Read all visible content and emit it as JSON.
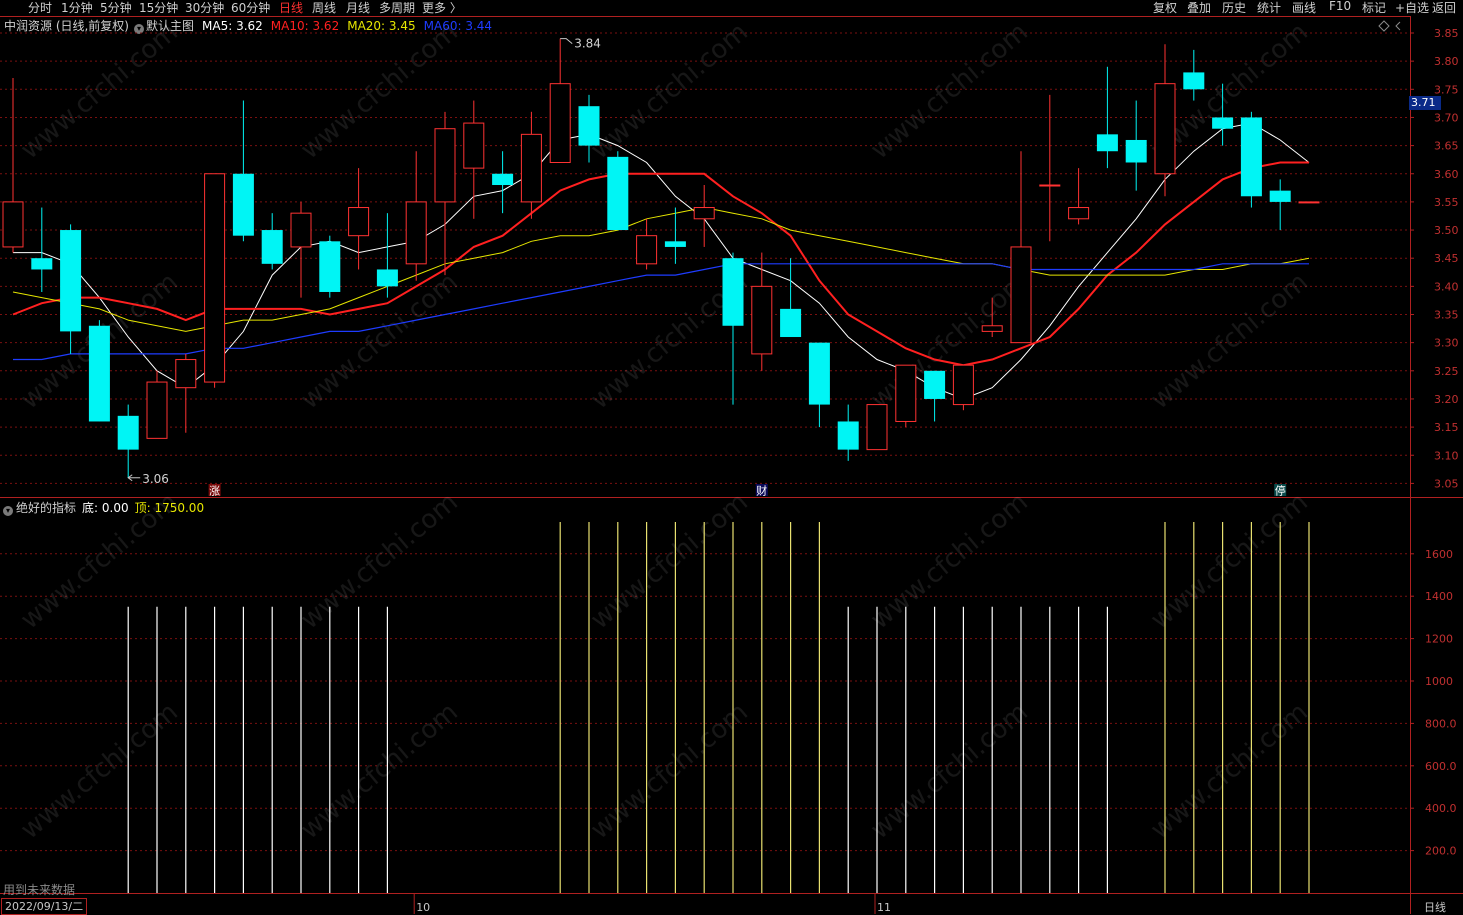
{
  "toolbar": {
    "left": [
      "分时",
      "1分钟",
      "5分钟",
      "15分钟",
      "30分钟",
      "60分钟",
      "日线",
      "周线",
      "月线",
      "多周期",
      "更多 〉"
    ],
    "active": "日线",
    "right": [
      "复权",
      "叠加",
      "历史",
      "统计",
      "画线",
      "F10",
      "标记",
      "+自选",
      "返回"
    ]
  },
  "legend": {
    "stock": "中润资源 (日线,前复权)",
    "template": "默认主图",
    "ma5": "MA5: 3.62",
    "ma10": "MA10: 3.62",
    "ma20": "MA20: 3.45",
    "ma60": "MA60: 3.44"
  },
  "indicator_legend": {
    "name": "绝好的指标",
    "bottom": "底: 0.00",
    "top": "顶: 1750.00"
  },
  "price_tag": "3.71",
  "future_note": "用到未来数据",
  "date_box": "2022/09/13/二",
  "period_label": "日线",
  "x_labels": [
    "10",
    "11"
  ],
  "markers": [
    "涨",
    "财",
    "停"
  ],
  "annotations": {
    "high": "3.84",
    "low": "3.06"
  },
  "colors": {
    "up": "#ff3232",
    "down": "#00f5f5",
    "ma5": "#ffffff",
    "ma10": "#ff2020",
    "ma20": "#e6e600",
    "ma60": "#1e3cff",
    "grid": "#7a1010",
    "bottom_line": "#ffffff",
    "top_line": "#e8e070"
  },
  "chart_data": [
    {
      "type": "candlestick",
      "title": "中润资源 (日线,前复权)",
      "y_ticks": [
        "3.85",
        "3.80",
        "3.75",
        "3.70",
        "3.65",
        "3.60",
        "3.55",
        "3.50",
        "3.45",
        "3.40",
        "3.35",
        "3.30",
        "3.25",
        "3.20",
        "3.15",
        "3.10",
        "3.05"
      ],
      "ylim": [
        3.03,
        3.87
      ],
      "candles": [
        {
          "o": 3.47,
          "h": 3.77,
          "l": 3.46,
          "c": 3.55
        },
        {
          "o": 3.45,
          "h": 3.54,
          "l": 3.39,
          "c": 3.43
        },
        {
          "o": 3.5,
          "h": 3.51,
          "l": 3.28,
          "c": 3.32
        },
        {
          "o": 3.33,
          "h": 3.34,
          "l": 3.16,
          "c": 3.16
        },
        {
          "o": 3.17,
          "h": 3.19,
          "l": 3.06,
          "c": 3.11
        },
        {
          "o": 3.13,
          "h": 3.25,
          "l": 3.13,
          "c": 3.23
        },
        {
          "o": 3.22,
          "h": 3.28,
          "l": 3.14,
          "c": 3.27
        },
        {
          "o": 3.23,
          "h": 3.6,
          "l": 3.22,
          "c": 3.6
        },
        {
          "o": 3.6,
          "h": 3.73,
          "l": 3.48,
          "c": 3.49
        },
        {
          "o": 3.5,
          "h": 3.53,
          "l": 3.43,
          "c": 3.44
        },
        {
          "o": 3.47,
          "h": 3.55,
          "l": 3.38,
          "c": 3.53
        },
        {
          "o": 3.48,
          "h": 3.49,
          "l": 3.38,
          "c": 3.39
        },
        {
          "o": 3.49,
          "h": 3.61,
          "l": 3.43,
          "c": 3.54
        },
        {
          "o": 3.43,
          "h": 3.53,
          "l": 3.38,
          "c": 3.4
        },
        {
          "o": 3.44,
          "h": 3.64,
          "l": 3.41,
          "c": 3.55
        },
        {
          "o": 3.55,
          "h": 3.71,
          "l": 3.42,
          "c": 3.68
        },
        {
          "o": 3.61,
          "h": 3.73,
          "l": 3.52,
          "c": 3.69
        },
        {
          "o": 3.6,
          "h": 3.64,
          "l": 3.53,
          "c": 3.58
        },
        {
          "o": 3.55,
          "h": 3.71,
          "l": 3.52,
          "c": 3.67
        },
        {
          "o": 3.62,
          "h": 3.84,
          "l": 3.62,
          "c": 3.76
        },
        {
          "o": 3.72,
          "h": 3.74,
          "l": 3.62,
          "c": 3.65
        },
        {
          "o": 3.63,
          "h": 3.64,
          "l": 3.51,
          "c": 3.5
        },
        {
          "o": 3.44,
          "h": 3.52,
          "l": 3.43,
          "c": 3.49
        },
        {
          "o": 3.48,
          "h": 3.54,
          "l": 3.44,
          "c": 3.47
        },
        {
          "o": 3.52,
          "h": 3.58,
          "l": 3.47,
          "c": 3.54
        },
        {
          "o": 3.45,
          "h": 3.46,
          "l": 3.19,
          "c": 3.33
        },
        {
          "o": 3.28,
          "h": 3.46,
          "l": 3.25,
          "c": 3.4
        },
        {
          "o": 3.36,
          "h": 3.45,
          "l": 3.34,
          "c": 3.31
        },
        {
          "o": 3.3,
          "h": 3.3,
          "l": 3.15,
          "c": 3.19
        },
        {
          "o": 3.16,
          "h": 3.19,
          "l": 3.09,
          "c": 3.11
        },
        {
          "o": 3.11,
          "h": 3.19,
          "l": 3.11,
          "c": 3.19
        },
        {
          "o": 3.16,
          "h": 3.26,
          "l": 3.15,
          "c": 3.26
        },
        {
          "o": 3.25,
          "h": 3.25,
          "l": 3.16,
          "c": 3.2
        },
        {
          "o": 3.19,
          "h": 3.26,
          "l": 3.18,
          "c": 3.26
        },
        {
          "o": 3.32,
          "h": 3.38,
          "l": 3.31,
          "c": 3.33
        },
        {
          "o": 3.3,
          "h": 3.64,
          "l": 3.3,
          "c": 3.47
        },
        {
          "o": 3.58,
          "h": 3.74,
          "l": 3.48,
          "c": 3.58
        },
        {
          "o": 3.52,
          "h": 3.61,
          "l": 3.51,
          "c": 3.54
        },
        {
          "o": 3.67,
          "h": 3.79,
          "l": 3.61,
          "c": 3.64
        },
        {
          "o": 3.66,
          "h": 3.73,
          "l": 3.57,
          "c": 3.62
        },
        {
          "o": 3.6,
          "h": 3.83,
          "l": 3.56,
          "c": 3.76
        },
        {
          "o": 3.78,
          "h": 3.82,
          "l": 3.73,
          "c": 3.75
        },
        {
          "o": 3.7,
          "h": 3.76,
          "l": 3.65,
          "c": 3.68
        },
        {
          "o": 3.7,
          "h": 3.71,
          "l": 3.54,
          "c": 3.56
        },
        {
          "o": 3.57,
          "h": 3.59,
          "l": 3.5,
          "c": 3.55
        },
        {
          "o": 3.55,
          "h": 3.55,
          "l": 3.55,
          "c": 3.55
        }
      ],
      "series": [
        {
          "name": "MA5",
          "values": [
            3.46,
            3.46,
            3.44,
            3.38,
            3.31,
            3.25,
            3.22,
            3.26,
            3.32,
            3.42,
            3.47,
            3.48,
            3.46,
            3.47,
            3.48,
            3.51,
            3.56,
            3.57,
            3.6,
            3.66,
            3.67,
            3.65,
            3.62,
            3.56,
            3.52,
            3.45,
            3.43,
            3.41,
            3.37,
            3.31,
            3.27,
            3.25,
            3.22,
            3.2,
            3.22,
            3.27,
            3.33,
            3.4,
            3.46,
            3.52,
            3.59,
            3.64,
            3.68,
            3.69,
            3.66,
            3.62
          ]
        },
        {
          "name": "MA10",
          "values": [
            3.35,
            3.37,
            3.38,
            3.38,
            3.37,
            3.36,
            3.34,
            3.36,
            3.36,
            3.36,
            3.36,
            3.35,
            3.36,
            3.37,
            3.4,
            3.43,
            3.47,
            3.49,
            3.53,
            3.57,
            3.59,
            3.6,
            3.6,
            3.6,
            3.6,
            3.56,
            3.53,
            3.49,
            3.41,
            3.35,
            3.32,
            3.29,
            3.27,
            3.26,
            3.27,
            3.29,
            3.31,
            3.36,
            3.42,
            3.46,
            3.51,
            3.55,
            3.59,
            3.61,
            3.62,
            3.62
          ]
        },
        {
          "name": "MA20",
          "values": [
            3.39,
            3.38,
            3.37,
            3.36,
            3.34,
            3.33,
            3.32,
            3.33,
            3.34,
            3.34,
            3.35,
            3.36,
            3.38,
            3.4,
            3.42,
            3.44,
            3.45,
            3.46,
            3.48,
            3.49,
            3.49,
            3.5,
            3.52,
            3.53,
            3.54,
            3.53,
            3.52,
            3.5,
            3.49,
            3.48,
            3.47,
            3.46,
            3.45,
            3.44,
            3.44,
            3.43,
            3.42,
            3.42,
            3.42,
            3.42,
            3.42,
            3.43,
            3.43,
            3.44,
            3.44,
            3.45
          ]
        },
        {
          "name": "MA60",
          "values": [
            3.27,
            3.27,
            3.28,
            3.28,
            3.28,
            3.28,
            3.28,
            3.29,
            3.29,
            3.3,
            3.31,
            3.32,
            3.32,
            3.33,
            3.34,
            3.35,
            3.36,
            3.37,
            3.38,
            3.39,
            3.4,
            3.41,
            3.42,
            3.42,
            3.43,
            3.44,
            3.44,
            3.44,
            3.44,
            3.44,
            3.44,
            3.44,
            3.44,
            3.44,
            3.44,
            3.43,
            3.43,
            3.43,
            3.43,
            3.43,
            3.43,
            3.43,
            3.44,
            3.44,
            3.44,
            3.44
          ]
        }
      ]
    },
    {
      "type": "bar",
      "title": "绝好的指标",
      "y_ticks": [
        "1600",
        "1400",
        "1200",
        "1000",
        "800.0",
        "600.0",
        "400.0",
        "200.0"
      ],
      "ylim": [
        0,
        1820
      ],
      "series": [
        {
          "name": "底",
          "values": [
            0,
            0,
            0,
            0,
            1350,
            1350,
            1350,
            1350,
            1350,
            1350,
            1350,
            1350,
            1350,
            1350,
            0,
            0,
            0,
            0,
            0,
            0,
            0,
            0,
            0,
            0,
            0,
            0,
            0,
            0,
            0,
            1350,
            1350,
            1350,
            1350,
            1350,
            1350,
            1350,
            1350,
            1350,
            1350,
            0,
            0,
            0,
            0,
            0,
            0,
            0
          ]
        },
        {
          "name": "顶",
          "values": [
            0,
            0,
            0,
            0,
            0,
            0,
            0,
            0,
            0,
            0,
            0,
            0,
            0,
            0,
            0,
            0,
            0,
            0,
            0,
            1750,
            1750,
            1750,
            1750,
            1750,
            1750,
            1750,
            1750,
            1750,
            1750,
            0,
            0,
            0,
            0,
            0,
            0,
            0,
            0,
            0,
            0,
            0,
            1750,
            1750,
            1750,
            1750,
            1750,
            1750
          ]
        }
      ]
    }
  ]
}
